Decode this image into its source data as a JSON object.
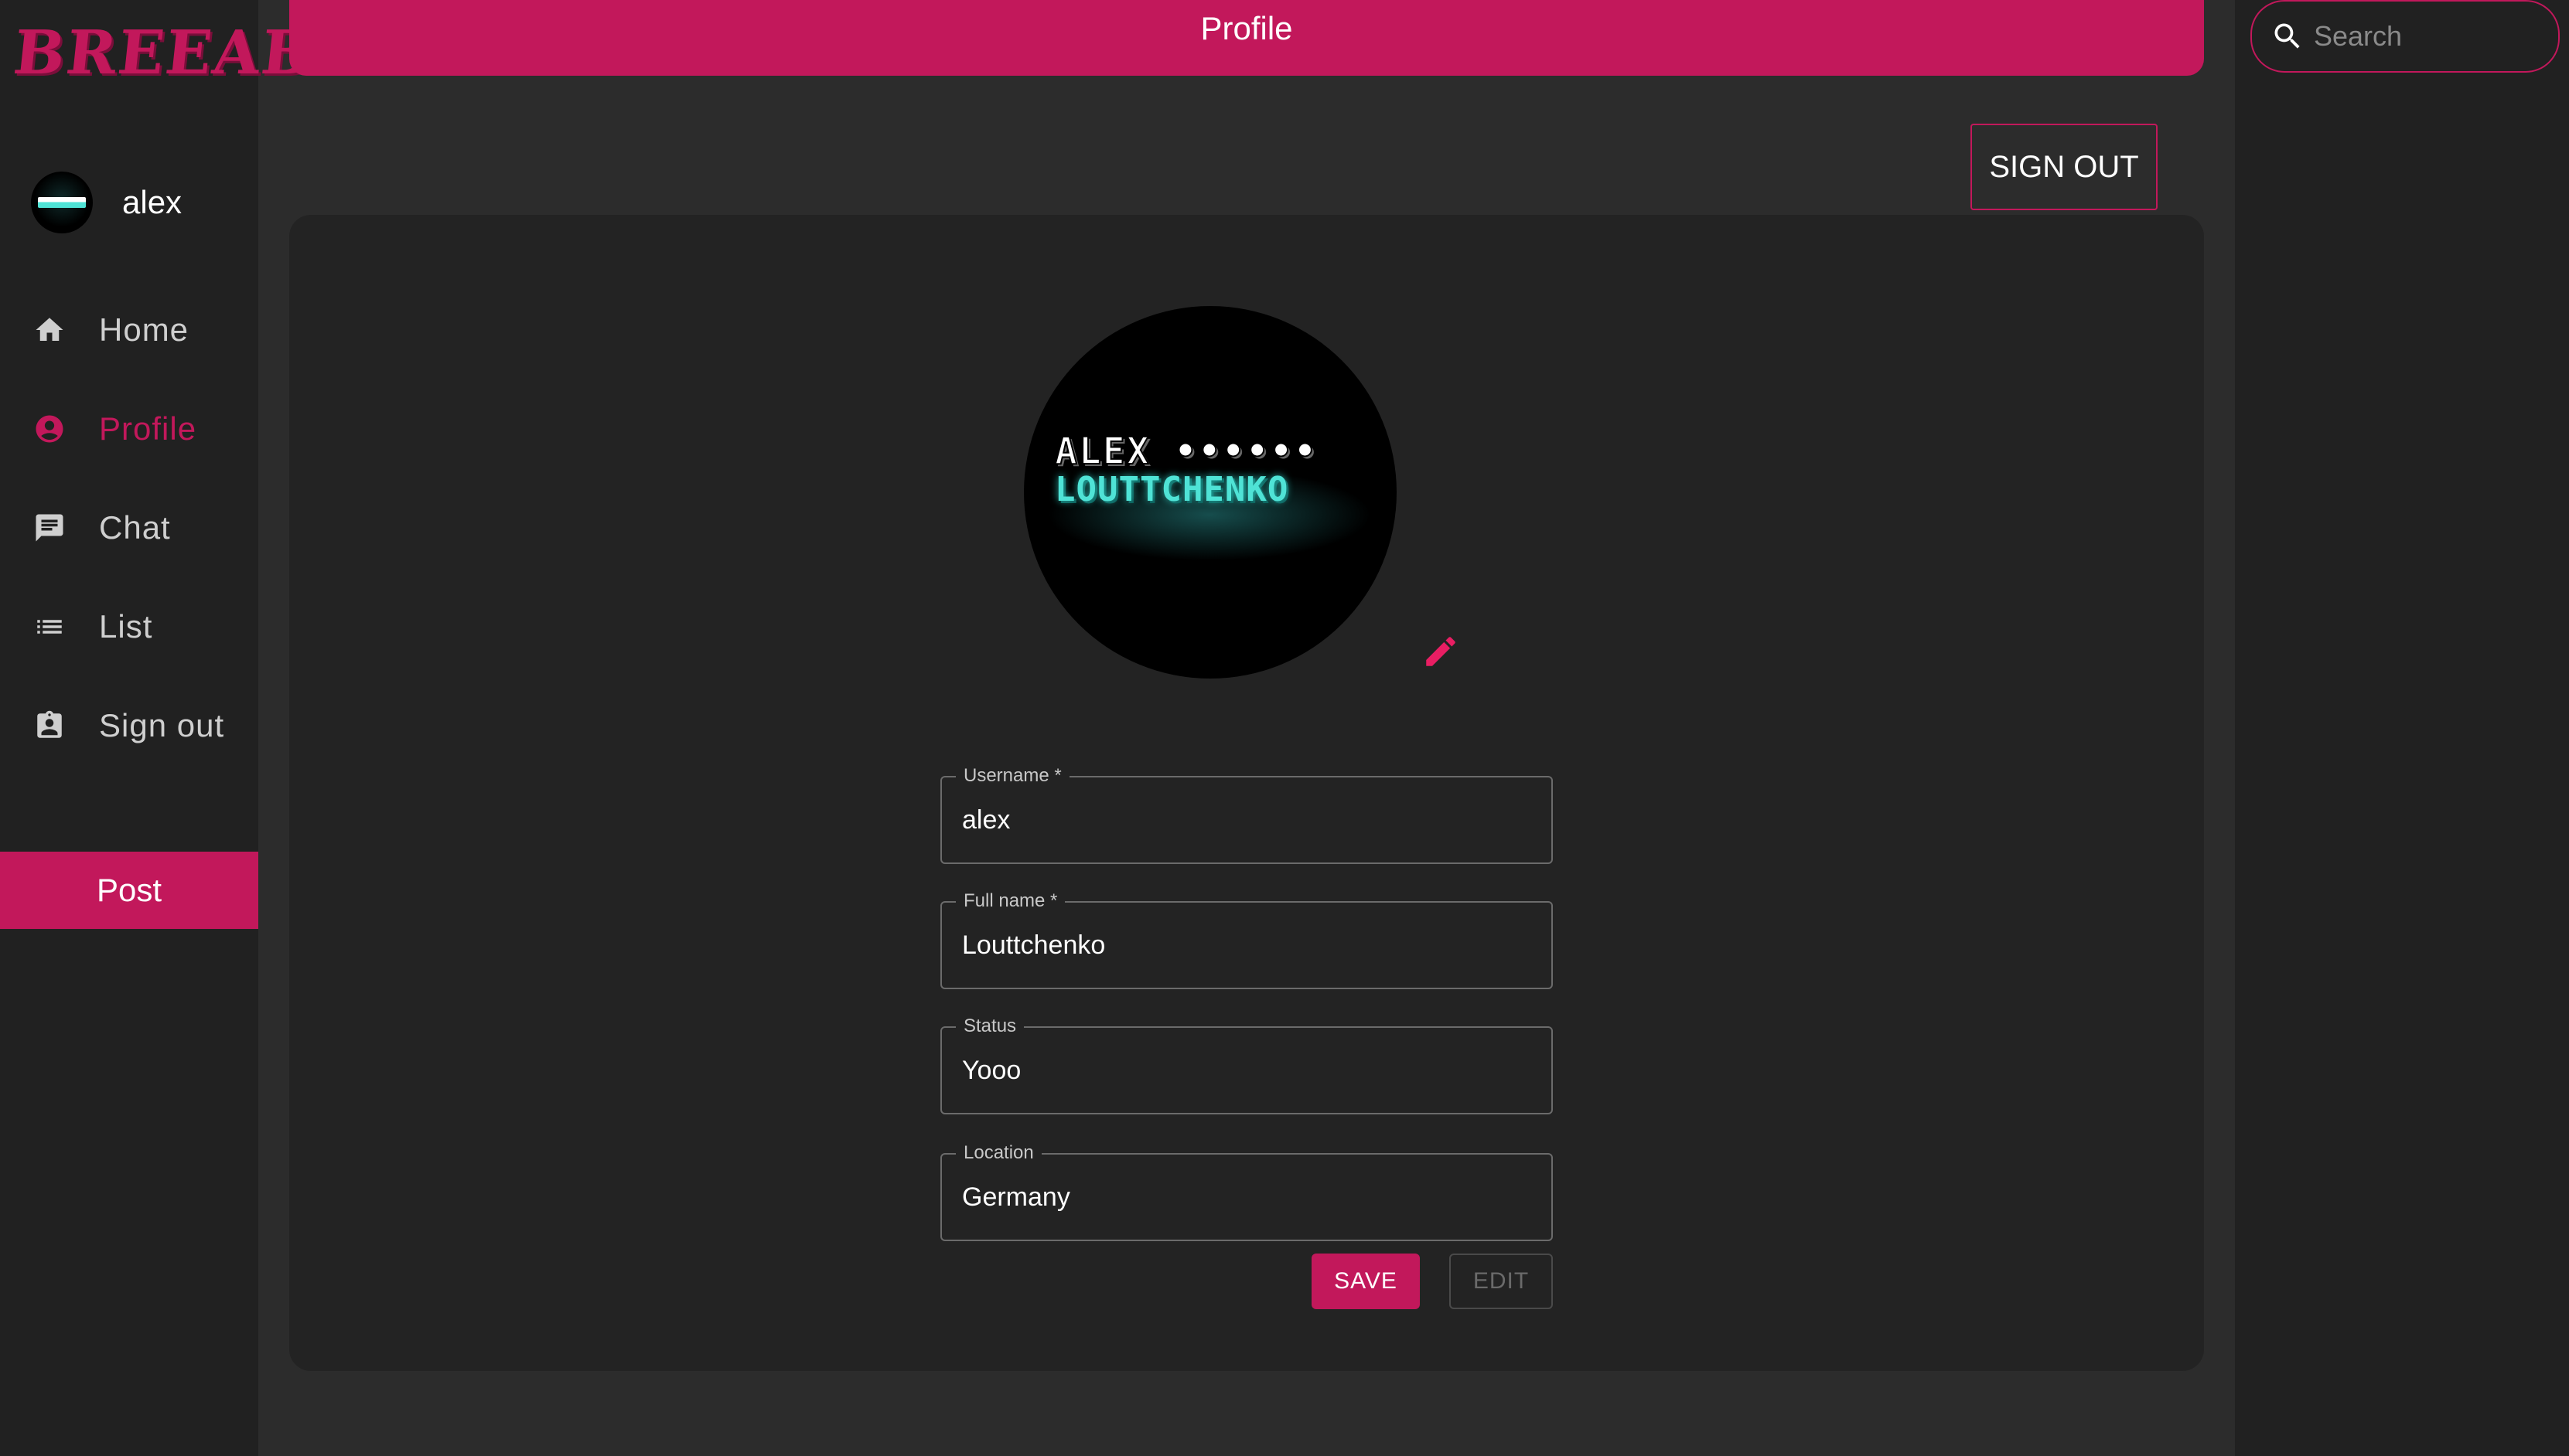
{
  "app": {
    "logo_text": "BREEAB",
    "accent_color": "#c2185b"
  },
  "sidebar": {
    "username": "alex",
    "avatar_icon": "user-avatar",
    "items": [
      {
        "label": "Home",
        "icon": "home-icon",
        "active": false
      },
      {
        "label": "Profile",
        "icon": "account-circle-icon",
        "active": true
      },
      {
        "label": "Chat",
        "icon": "chat-icon",
        "active": false
      },
      {
        "label": "List",
        "icon": "list-icon",
        "active": false
      },
      {
        "label": "Sign out",
        "icon": "badge-icon",
        "active": false
      }
    ],
    "post_label": "Post"
  },
  "header": {
    "title": "Profile"
  },
  "actions": {
    "signout_label": "SIGN OUT"
  },
  "profile": {
    "avatar_text_line1": "ALEX ••••••",
    "avatar_text_line2": "LOUTTCHENKO",
    "fields": [
      {
        "label": "Username *",
        "value": "alex"
      },
      {
        "label": "Full name *",
        "value": "Louttchenko"
      },
      {
        "label": "Status",
        "value": "Yooo"
      },
      {
        "label": "Location",
        "value": "Germany"
      }
    ],
    "save_label": "SAVE",
    "edit_label": "EDIT"
  },
  "search": {
    "placeholder": "Search"
  }
}
